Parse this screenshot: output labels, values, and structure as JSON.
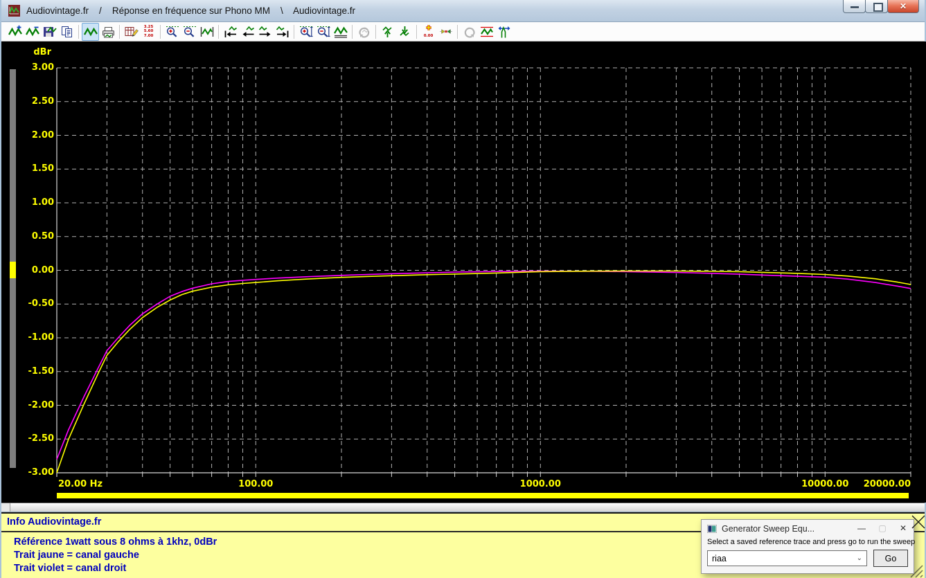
{
  "window": {
    "title": "Audiovintage.fr    /    Réponse en fréquence sur Phono MM    \\    Audiovintage.fr"
  },
  "toolbar": {
    "buttons": [
      {
        "name": "add-trace-button",
        "icon": "trace-add"
      },
      {
        "name": "subtract-trace-button",
        "icon": "trace-subtract"
      },
      {
        "name": "save-trace-button",
        "icon": "save-trace"
      },
      {
        "name": "copy-button",
        "icon": "copy"
      },
      {
        "sep": true
      },
      {
        "name": "display-trace-button",
        "icon": "wave",
        "selected": true
      },
      {
        "name": "print-trace-button",
        "icon": "print"
      },
      {
        "sep": true
      },
      {
        "name": "edit-data-button",
        "icon": "edit-table"
      },
      {
        "name": "show-values-button",
        "icon": "values",
        "caption": "3.25\n5.60\n7.00"
      },
      {
        "sep": true
      },
      {
        "name": "zoom-in-button",
        "icon": "zoom-in"
      },
      {
        "name": "zoom-out-button",
        "icon": "zoom-out"
      },
      {
        "name": "fit-trace-button",
        "icon": "wave-bounded"
      },
      {
        "sep": true
      },
      {
        "name": "pan-first-button",
        "icon": "wave-first"
      },
      {
        "name": "pan-left-button",
        "icon": "wave-left"
      },
      {
        "name": "pan-right-button",
        "icon": "wave-right"
      },
      {
        "name": "pan-last-button",
        "icon": "wave-last"
      },
      {
        "sep": true
      },
      {
        "name": "zoom-y-in-button",
        "icon": "zoom-y-in"
      },
      {
        "name": "zoom-y-out-button",
        "icon": "zoom-y-out"
      },
      {
        "name": "autoscale-button",
        "icon": "wave-underline"
      },
      {
        "sep": true
      },
      {
        "name": "rotate-button",
        "icon": "rotate",
        "disabled": true
      },
      {
        "sep": true
      },
      {
        "name": "shift-up-button",
        "icon": "wave-up"
      },
      {
        "name": "shift-down-button",
        "icon": "wave-down"
      },
      {
        "sep": true
      },
      {
        "name": "cursor-readout-button",
        "icon": "cursor-plus",
        "caption": "0.00"
      },
      {
        "name": "markers-button",
        "icon": "arrows-inward"
      },
      {
        "sep": true
      },
      {
        "name": "redo-button",
        "icon": "redo",
        "disabled": true
      },
      {
        "name": "limit-lines-button",
        "icon": "wave-limits"
      },
      {
        "name": "sweep-cursor-button",
        "icon": "sweep-cursor"
      }
    ]
  },
  "chart_data": {
    "type": "line",
    "x_scale": "log",
    "xlim": [
      20,
      20000
    ],
    "ylim": [
      -3,
      3
    ],
    "ylabel": "dBr",
    "grid": "dashed",
    "background": "#000000",
    "grid_color": "#b2b2b2",
    "axis_color": "#d8d8d8",
    "label_color": "#ffff00",
    "y_ticks": [
      {
        "v": 3.0,
        "label": "3.00"
      },
      {
        "v": 2.5,
        "label": "2.50"
      },
      {
        "v": 2.0,
        "label": "2.00"
      },
      {
        "v": 1.5,
        "label": "1.50"
      },
      {
        "v": 1.0,
        "label": "1.00"
      },
      {
        "v": 0.5,
        "label": "0.50"
      },
      {
        "v": 0.0,
        "label": "0.00"
      },
      {
        "v": -0.5,
        "label": "-0.50"
      },
      {
        "v": -1.0,
        "label": "-1.00"
      },
      {
        "v": -1.5,
        "label": "-1.50"
      },
      {
        "v": -2.0,
        "label": "-2.00"
      },
      {
        "v": -2.5,
        "label": "-2.50"
      },
      {
        "v": -3.0,
        "label": "-3.00"
      }
    ],
    "x_ticks": [
      {
        "f": 20,
        "label": "20.00 Hz",
        "align": "left"
      },
      {
        "f": 100,
        "label": "100.00"
      },
      {
        "f": 1000,
        "label": "1000.00"
      },
      {
        "f": 10000,
        "label": "10000.00"
      },
      {
        "f": 20000,
        "label": "20000.00",
        "align": "right"
      }
    ],
    "series": [
      {
        "name": "canal droit (trait violet)",
        "color": "#ff00ff",
        "points": [
          [
            20,
            -2.8
          ],
          [
            22,
            -2.36
          ],
          [
            25,
            -1.86
          ],
          [
            28,
            -1.44
          ],
          [
            30,
            -1.19
          ],
          [
            33,
            -0.99
          ],
          [
            36,
            -0.82
          ],
          [
            40,
            -0.645
          ],
          [
            45,
            -0.5
          ],
          [
            50,
            -0.385
          ],
          [
            55,
            -0.315
          ],
          [
            60,
            -0.265
          ],
          [
            70,
            -0.2
          ],
          [
            80,
            -0.165
          ],
          [
            90,
            -0.148
          ],
          [
            100,
            -0.135
          ],
          [
            120,
            -0.115
          ],
          [
            150,
            -0.095
          ],
          [
            200,
            -0.075
          ],
          [
            250,
            -0.06
          ],
          [
            300,
            -0.05
          ],
          [
            400,
            -0.037
          ],
          [
            500,
            -0.027
          ],
          [
            700,
            -0.017
          ],
          [
            1000,
            -0.012
          ],
          [
            1500,
            -0.014
          ],
          [
            2000,
            -0.02
          ],
          [
            3000,
            -0.032
          ],
          [
            4000,
            -0.045
          ],
          [
            5000,
            -0.057
          ],
          [
            6000,
            -0.07
          ],
          [
            8000,
            -0.088
          ],
          [
            10000,
            -0.103
          ],
          [
            12000,
            -0.13
          ],
          [
            15000,
            -0.18
          ],
          [
            18000,
            -0.235
          ],
          [
            20000,
            -0.27
          ]
        ]
      },
      {
        "name": "canal gauche (trait jaune)",
        "color": "#ffff00",
        "points": [
          [
            20,
            -3.0
          ],
          [
            22,
            -2.5
          ],
          [
            25,
            -1.97
          ],
          [
            28,
            -1.52
          ],
          [
            30,
            -1.26
          ],
          [
            33,
            -1.05
          ],
          [
            36,
            -0.88
          ],
          [
            40,
            -0.7
          ],
          [
            45,
            -0.55
          ],
          [
            50,
            -0.44
          ],
          [
            55,
            -0.36
          ],
          [
            60,
            -0.31
          ],
          [
            70,
            -0.25
          ],
          [
            80,
            -0.215
          ],
          [
            90,
            -0.195
          ],
          [
            100,
            -0.18
          ],
          [
            120,
            -0.155
          ],
          [
            150,
            -0.13
          ],
          [
            200,
            -0.105
          ],
          [
            250,
            -0.09
          ],
          [
            300,
            -0.08
          ],
          [
            400,
            -0.065
          ],
          [
            500,
            -0.055
          ],
          [
            700,
            -0.04
          ],
          [
            1000,
            -0.02
          ],
          [
            1500,
            -0.012
          ],
          [
            2000,
            -0.01
          ],
          [
            3000,
            -0.01
          ],
          [
            4000,
            -0.015
          ],
          [
            5000,
            -0.02
          ],
          [
            6000,
            -0.03
          ],
          [
            8000,
            -0.045
          ],
          [
            10000,
            -0.062
          ],
          [
            12000,
            -0.085
          ],
          [
            15000,
            -0.125
          ],
          [
            18000,
            -0.175
          ],
          [
            20000,
            -0.21
          ]
        ]
      }
    ]
  },
  "info_panel": {
    "title": "Info Audiovintage.fr",
    "lines": [
      "Référence 1watt sous 8 ohms à 1khz, 0dBr",
      "Trait jaune = canal gauche",
      "Trait violet = canal droit"
    ]
  },
  "sweep_dialog": {
    "title": "Generator Sweep Equ...",
    "instruction": "Select a saved reference trace and press go to run the sweep",
    "combo_value": "riaa",
    "go_label": "Go"
  }
}
